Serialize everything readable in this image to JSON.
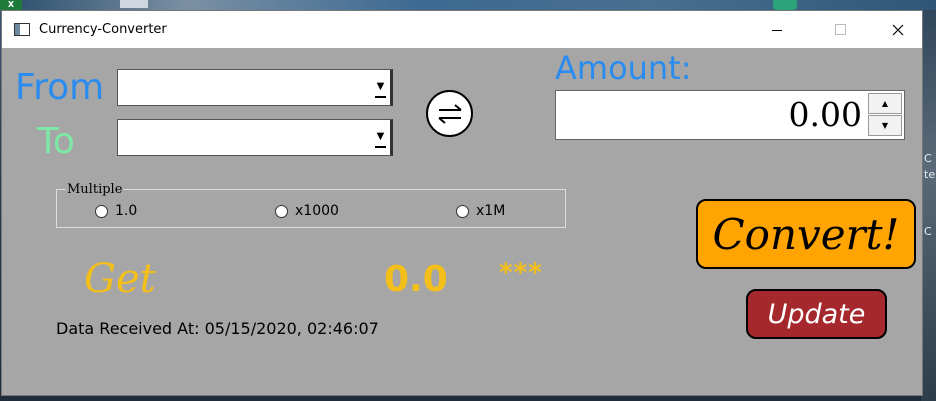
{
  "desktop": {
    "excel_badge": "X",
    "right_letters": [
      "C",
      "te",
      "C"
    ]
  },
  "window": {
    "title": "Currency-Converter"
  },
  "from": {
    "label": "From",
    "selected": ""
  },
  "to": {
    "label": "To",
    "selected": ""
  },
  "amount": {
    "label": "Amount:",
    "value": "0.00"
  },
  "multiple": {
    "legend": "Multiple",
    "options": [
      "1.0",
      "x1000",
      "x1M"
    ]
  },
  "result": {
    "label": "Get",
    "value": "0.0",
    "currency": "***"
  },
  "status": {
    "data_received": "Data Received At: 05/15/2020, 02:46:07"
  },
  "buttons": {
    "convert": "Convert!",
    "update": "Update"
  },
  "colors": {
    "accent_blue": "#2b8cf0",
    "to_green": "#7de8a5",
    "result_gold": "#f5bf1a",
    "convert_orange": "#ffa400",
    "update_red": "#a5292c",
    "window_bg": "#a6a6a6"
  },
  "icons": {
    "swap": "swap-arrows-icon",
    "dropdown": "chevron-down-icon",
    "spin_up": "caret-up-icon",
    "spin_down": "caret-down-icon"
  }
}
